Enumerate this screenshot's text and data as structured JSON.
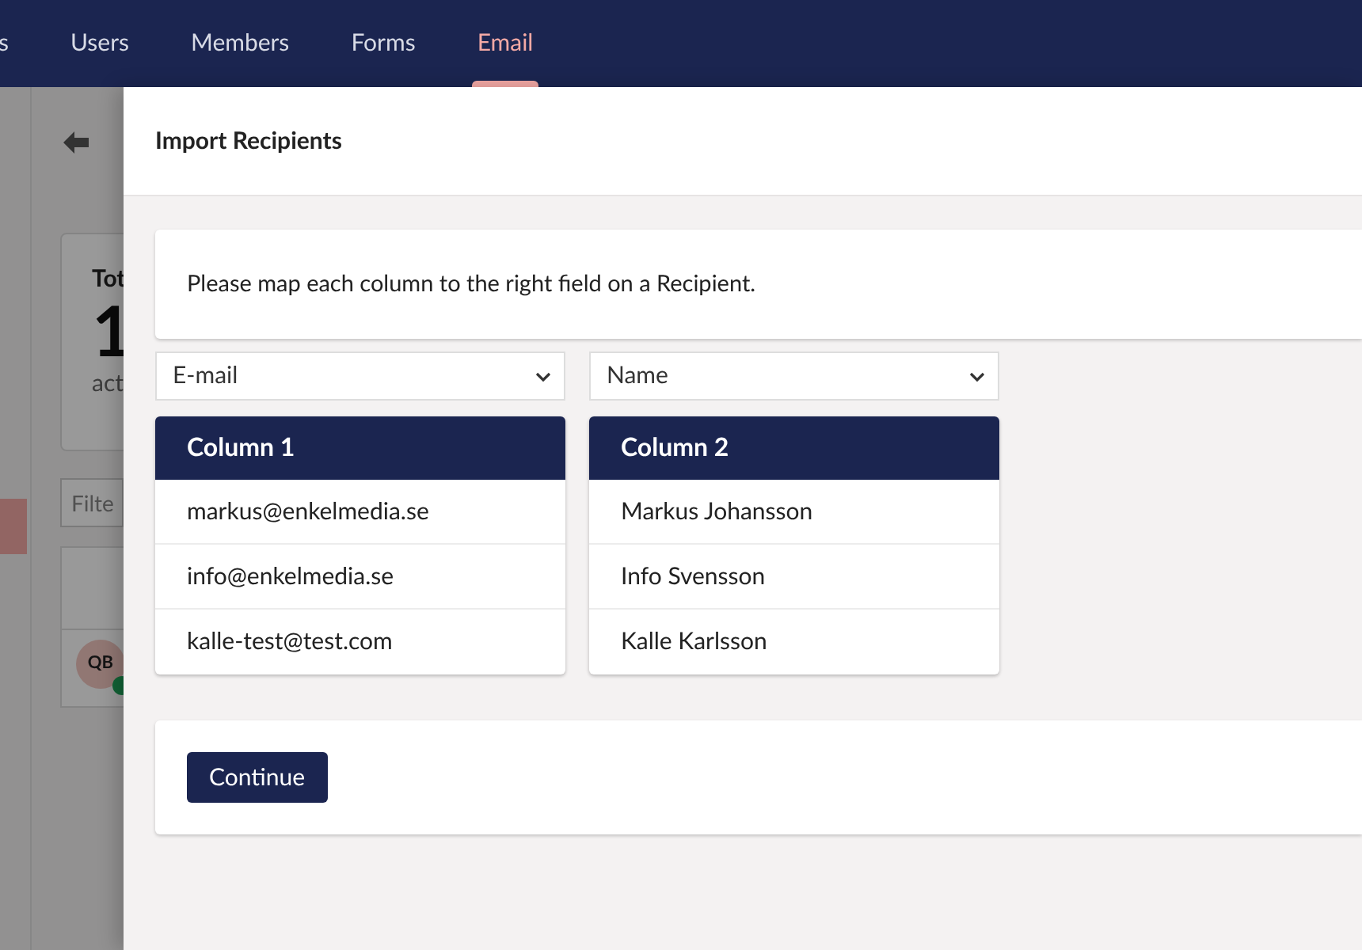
{
  "nav": {
    "items": [
      {
        "label": "s",
        "selected": false
      },
      {
        "label": "Users",
        "selected": false
      },
      {
        "label": "Members",
        "selected": false
      },
      {
        "label": "Forms",
        "selected": false
      },
      {
        "label": "Email",
        "selected": true
      }
    ]
  },
  "background": {
    "stat_card": {
      "title": "Tot",
      "value": "1",
      "caption": "act"
    },
    "filter": {
      "placeholder": "Filte"
    },
    "list_row": {
      "avatar": "QB",
      "online": true
    }
  },
  "dialog": {
    "title": "Import Recipients",
    "instructions": "Please map each column to the right field on a Recipient.",
    "columns": [
      {
        "field": "E-mail",
        "heading": "Column 1",
        "cells": [
          "markus@enkelmedia.se",
          "info@enkelmedia.se",
          "kalle-test@test.com"
        ]
      },
      {
        "field": "Name",
        "heading": "Column 2",
        "cells": [
          "Markus Johansson",
          "Info Svensson",
          "Kalle Karlsson"
        ]
      }
    ],
    "continue_button": "Continue"
  }
}
